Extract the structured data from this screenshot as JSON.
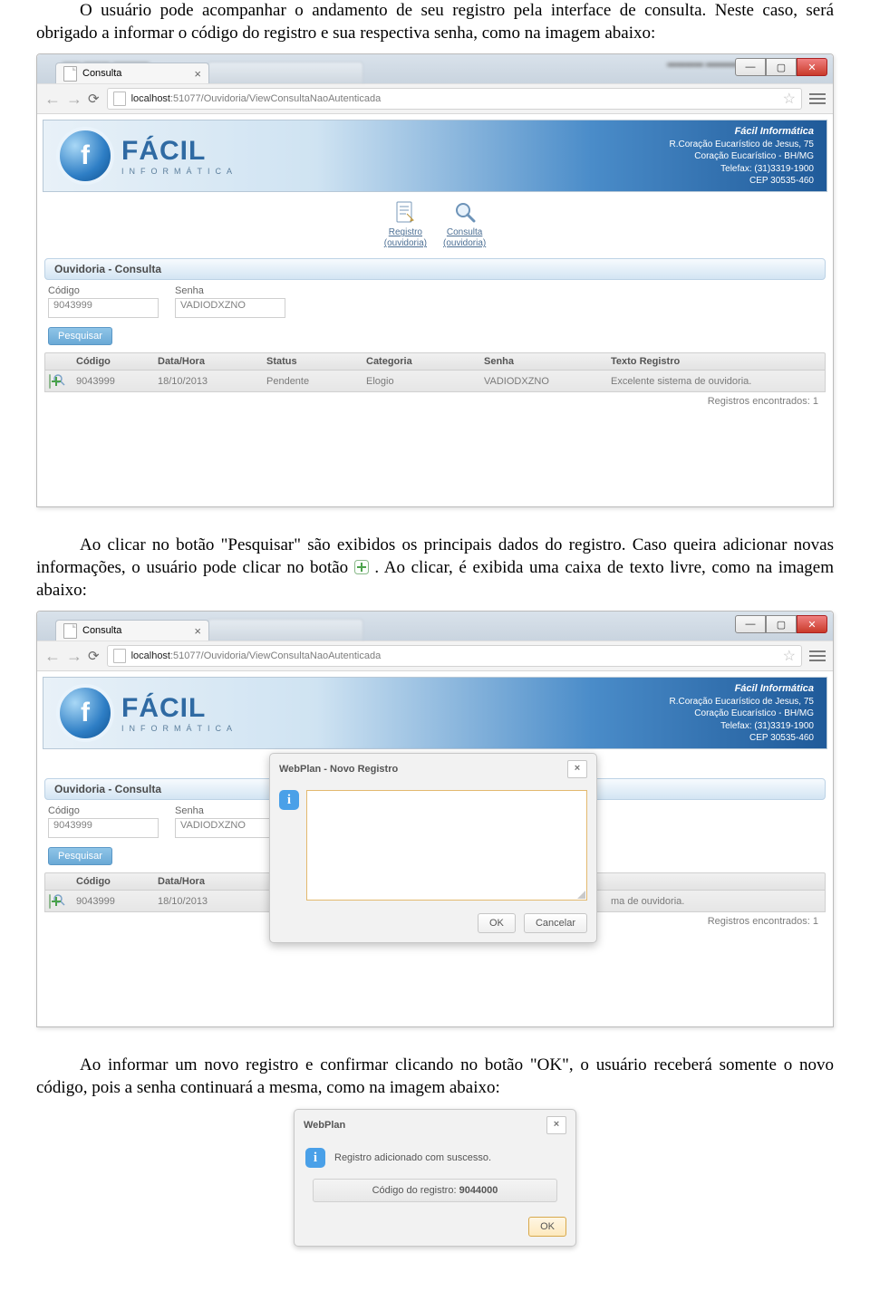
{
  "doc": {
    "p1": "O usuário pode acompanhar o andamento de seu registro pela interface de consulta. Neste caso, será obrigado a informar o código do registro e sua respectiva senha, como na imagem abaixo:",
    "p2a": "Ao clicar no botão \"Pesquisar\" são exibidos os principais dados do registro. Caso queira adicionar novas informações, o usuário pode clicar no botão ",
    "p2b": " . Ao clicar, é exibida uma caixa de texto livre, como na imagem abaixo:",
    "p3": "Ao informar um novo registro e confirmar clicando no botão \"OK\", o usuário receberá somente o novo código, pois a senha continuará a mesma, como na imagem abaixo:"
  },
  "browser": {
    "tab_title": "Consulta",
    "url_host": "localhost",
    "url_port": ":51077",
    "url_path": "/Ouvidoria/ViewConsultaNaoAutenticada"
  },
  "banner": {
    "logo_main": "FÁCIL",
    "logo_sub": "INFORMÁTICA",
    "company_title": "Fácil Informática",
    "l1": "R.Coração Eucarístico de Jesus, 75",
    "l2": "Coração Eucarístico - BH/MG",
    "l3": "Telefax: (31)3319-1900",
    "l4": "CEP 30535-460"
  },
  "menu": {
    "registro1": "Registro",
    "registro2": "(ouvidoria)",
    "consulta1": "Consulta",
    "consulta2": "(ouvidoria)"
  },
  "panel": {
    "title": "Ouvidoria - Consulta",
    "codigo_label": "Código",
    "senha_label": "Senha",
    "codigo_value": "9043999",
    "senha_value": "VADIODXZNO",
    "search_btn": "Pesquisar"
  },
  "grid": {
    "h_codigo": "Código",
    "h_data": "Data/Hora",
    "h_status": "Status",
    "h_categoria": "Categoria",
    "h_senha": "Senha",
    "h_texto": "Texto Registro",
    "row": {
      "codigo": "9043999",
      "data": "18/10/2013",
      "status": "Pendente",
      "categoria": "Elogio",
      "senha": "VADIODXZNO",
      "texto": "Excelente sistema de ouvidoria.",
      "texto_trunc": "ma de ouvidoria."
    },
    "count_label": "Registros encontrados: 1"
  },
  "modal": {
    "title": "WebPlan - Novo Registro",
    "ok": "OK",
    "cancel": "Cancelar"
  },
  "confirm": {
    "title": "WebPlan",
    "msg": "Registro adicionado com suscesso.",
    "code_label": "Código do registro: ",
    "code": "9044000",
    "ok": "OK"
  }
}
